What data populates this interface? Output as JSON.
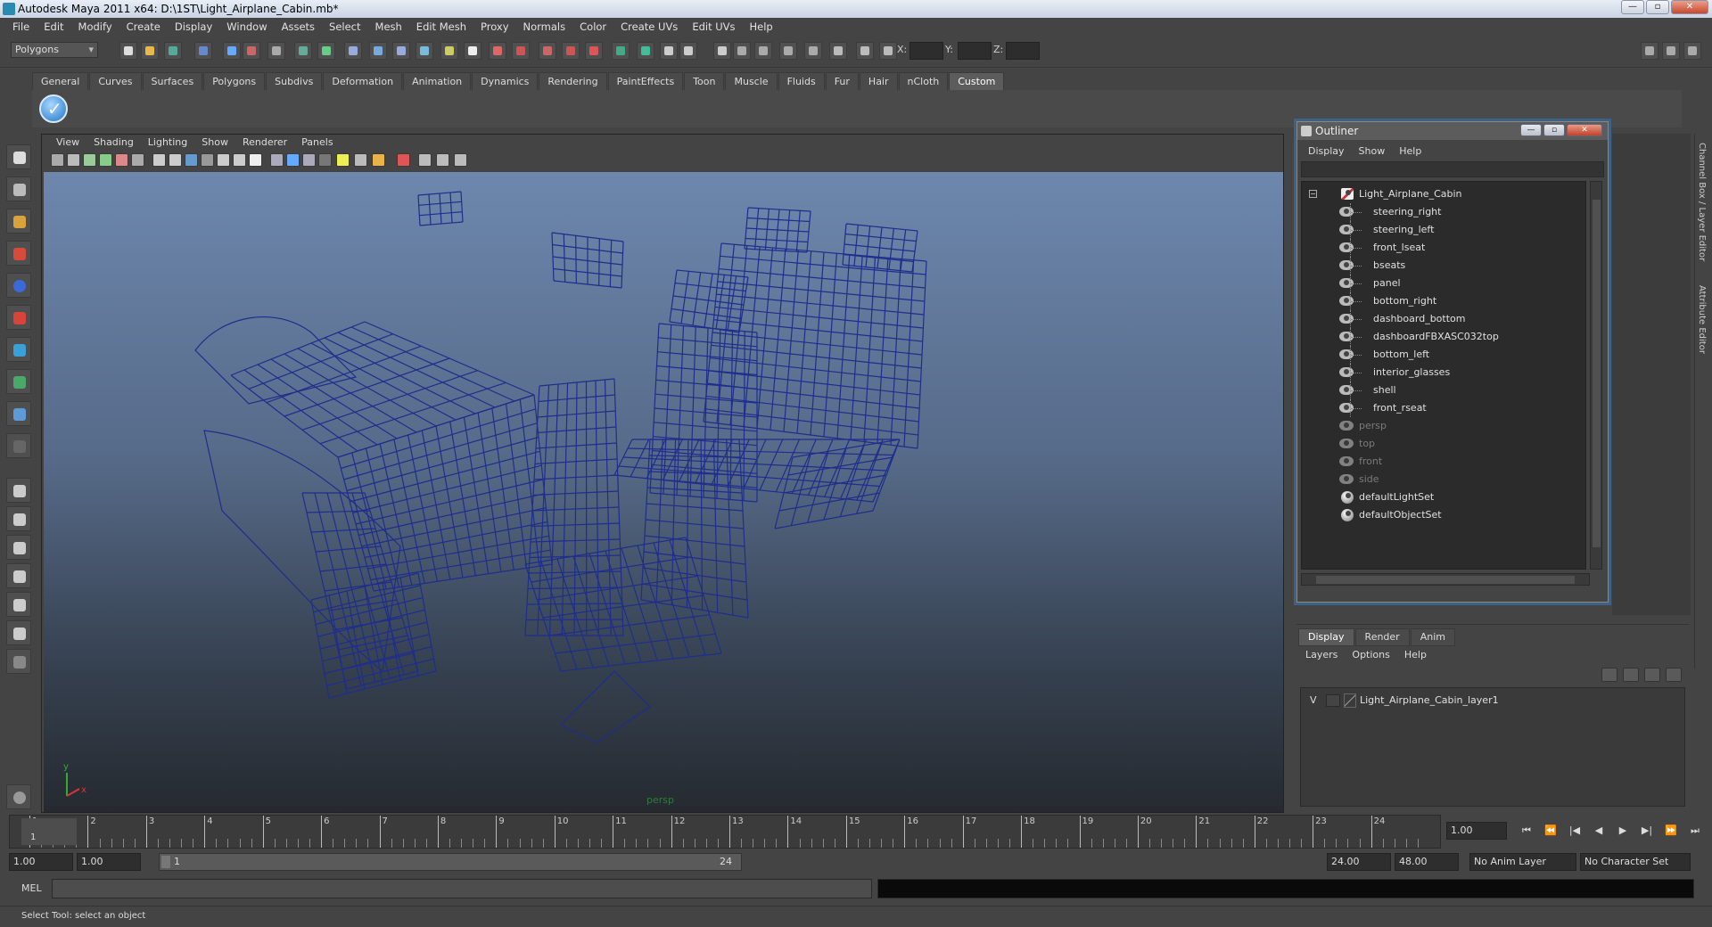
{
  "window": {
    "title": "Autodesk Maya 2011 x64: D:\\1ST\\Light_Airplane_Cabin.mb*",
    "buttons": [
      "—",
      "▫",
      "✕"
    ]
  },
  "menubar": [
    "File",
    "Edit",
    "Modify",
    "Create",
    "Display",
    "Window",
    "Assets",
    "Select",
    "Mesh",
    "Edit Mesh",
    "Proxy",
    "Normals",
    "Color",
    "Create UVs",
    "Edit UVs",
    "Help"
  ],
  "status_line": {
    "mode": "Polygons",
    "x_label": "X:",
    "y_label": "Y:",
    "z_label": "Z:"
  },
  "shelf": {
    "tabs": [
      "General",
      "Curves",
      "Surfaces",
      "Polygons",
      "Subdivs",
      "Deformation",
      "Animation",
      "Dynamics",
      "Rendering",
      "PaintEffects",
      "Toon",
      "Muscle",
      "Fluids",
      "Fur",
      "Hair",
      "nCloth",
      "Custom"
    ],
    "active_tab": "Custom"
  },
  "viewport": {
    "menu": [
      "View",
      "Shading",
      "Lighting",
      "Show",
      "Renderer",
      "Panels"
    ],
    "camera": "persp",
    "wire_color": "#1f2d8c",
    "axis_labels": {
      "y": "y",
      "x": "x"
    }
  },
  "outliner": {
    "title": "Outliner",
    "menu": [
      "Display",
      "Show",
      "Help"
    ],
    "items": [
      {
        "label": "Light_Airplane_Cabin",
        "level": 0,
        "kind": "group",
        "dim": false
      },
      {
        "label": "steering_right",
        "level": 1,
        "kind": "mesh",
        "dim": false
      },
      {
        "label": "steering_left",
        "level": 1,
        "kind": "mesh",
        "dim": false
      },
      {
        "label": "front_lseat",
        "level": 1,
        "kind": "mesh",
        "dim": false
      },
      {
        "label": "bseats",
        "level": 1,
        "kind": "mesh",
        "dim": false
      },
      {
        "label": "panel",
        "level": 1,
        "kind": "mesh",
        "dim": false
      },
      {
        "label": "bottom_right",
        "level": 1,
        "kind": "mesh",
        "dim": false
      },
      {
        "label": "dashboard_bottom",
        "level": 1,
        "kind": "mesh",
        "dim": false
      },
      {
        "label": "dashboardFBXASC032top",
        "level": 1,
        "kind": "mesh",
        "dim": false
      },
      {
        "label": "bottom_left",
        "level": 1,
        "kind": "mesh",
        "dim": false
      },
      {
        "label": "interior_glasses",
        "level": 1,
        "kind": "mesh",
        "dim": false
      },
      {
        "label": "shell",
        "level": 1,
        "kind": "mesh",
        "dim": false
      },
      {
        "label": "front_rseat",
        "level": 1,
        "kind": "mesh",
        "dim": false
      },
      {
        "label": "persp",
        "level": 0,
        "kind": "camera",
        "dim": true
      },
      {
        "label": "top",
        "level": 0,
        "kind": "camera",
        "dim": true
      },
      {
        "label": "front",
        "level": 0,
        "kind": "camera",
        "dim": true
      },
      {
        "label": "side",
        "level": 0,
        "kind": "camera",
        "dim": true
      },
      {
        "label": "defaultLightSet",
        "level": 0,
        "kind": "set",
        "dim": false
      },
      {
        "label": "defaultObjectSet",
        "level": 0,
        "kind": "set",
        "dim": false
      }
    ]
  },
  "side_tabs": [
    "Channel Box / Layer Editor",
    "Attribute Editor"
  ],
  "layer_editor": {
    "tabs": [
      "Display",
      "Render",
      "Anim"
    ],
    "active_tab": "Display",
    "menu": [
      "Layers",
      "Options",
      "Help"
    ],
    "layers": [
      {
        "visible": "V",
        "name": "Light_Airplane_Cabin_layer1"
      }
    ]
  },
  "time_slider": {
    "ticks": [
      1,
      2,
      3,
      4,
      5,
      6,
      7,
      8,
      9,
      10,
      11,
      12,
      13,
      14,
      15,
      16,
      17,
      18,
      19,
      20,
      21,
      22,
      23,
      24
    ],
    "current_frame": "1",
    "current_time_field": "1.00",
    "playback_buttons": [
      "⏮",
      "⏪",
      "|◀",
      "◀",
      "▶",
      "▶|",
      "⏩",
      "⏭"
    ]
  },
  "range_slider": {
    "start_time": "1.00",
    "playback_start": "1.00",
    "range_start_label": "1",
    "range_end_label": "24",
    "playback_end": "24.00",
    "end_time": "48.00",
    "anim_layer": "No Anim Layer",
    "character_set": "No Character Set"
  },
  "command_line": {
    "label": "MEL"
  },
  "help_line": {
    "text": "Select Tool: select an object"
  }
}
